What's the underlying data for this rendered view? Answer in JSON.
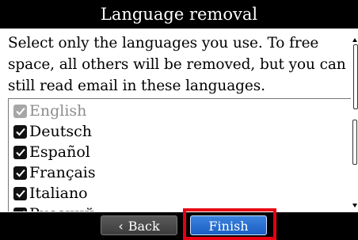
{
  "dialog": {
    "title": "Language removal",
    "description": "Select only the languages you use. To free space, all others will be removed, but you can still read email in these languages."
  },
  "languages": [
    {
      "label": "English",
      "checked": true,
      "disabled": true
    },
    {
      "label": "Deutsch",
      "checked": true,
      "disabled": false
    },
    {
      "label": "Español",
      "checked": true,
      "disabled": false
    },
    {
      "label": "Français",
      "checked": true,
      "disabled": false
    },
    {
      "label": "Italiano",
      "checked": true,
      "disabled": false
    },
    {
      "label": "Русский",
      "checked": true,
      "disabled": false
    }
  ],
  "buttons": {
    "back": "Back",
    "finish": "Finish"
  },
  "colors": {
    "highlight": "#e60012",
    "finish_button": "#2a6fd0",
    "checkbox_disabled": "#a7a7a7"
  }
}
